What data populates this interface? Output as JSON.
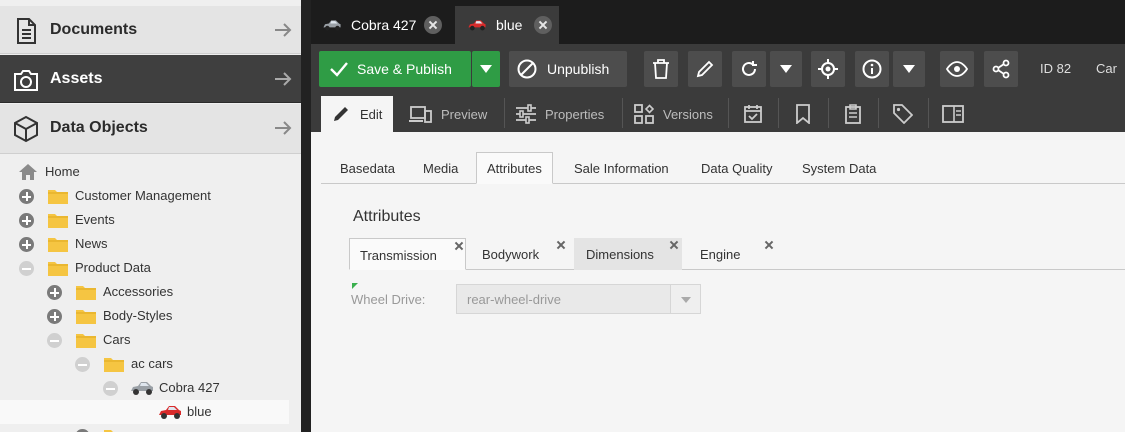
{
  "colors": {
    "accent_green": "#2f9c45",
    "dark_bar": "#3b3b3b",
    "car_grey": "#9aa0a6",
    "car_red": "#d92b2b",
    "folder": "#f5c542"
  },
  "sidebar": {
    "sections": [
      {
        "label": "Documents",
        "icon": "document-icon"
      },
      {
        "label": "Assets",
        "icon": "camera-icon"
      },
      {
        "label": "Data Objects",
        "icon": "cube-icon"
      }
    ],
    "tree": [
      {
        "label": "Home",
        "icon": "home-icon",
        "toggle": "none"
      },
      {
        "label": "Customer Management",
        "icon": "folder-icon",
        "toggle": "plus"
      },
      {
        "label": "Events",
        "icon": "folder-icon",
        "toggle": "plus"
      },
      {
        "label": "News",
        "icon": "folder-icon",
        "toggle": "plus"
      },
      {
        "label": "Product Data",
        "icon": "folder-icon",
        "toggle": "minus"
      },
      {
        "label": "Accessories",
        "icon": "folder-icon",
        "toggle": "plus"
      },
      {
        "label": "Body-Styles",
        "icon": "folder-icon",
        "toggle": "plus"
      },
      {
        "label": "Cars",
        "icon": "folder-icon",
        "toggle": "minus"
      },
      {
        "label": "ac cars",
        "icon": "folder-icon",
        "toggle": "minus"
      },
      {
        "label": "Cobra 427",
        "icon": "car-grey-icon",
        "toggle": "minus"
      },
      {
        "label": "blue",
        "icon": "car-red-icon",
        "toggle": "none",
        "selected": true
      }
    ]
  },
  "doc_tabs": [
    {
      "label": "Cobra 427",
      "icon": "car-grey-icon"
    },
    {
      "label": "blue",
      "icon": "car-red-icon",
      "active": true
    }
  ],
  "toolbar": {
    "save_publish": "Save & Publish",
    "unpublish": "Unpublish",
    "id_label": "ID 82",
    "class_label": "Car"
  },
  "edit_tabs": [
    {
      "label": "Edit",
      "icon": "pencil-icon",
      "active": true
    },
    {
      "label": "Preview",
      "icon": "devices-icon"
    },
    {
      "label": "Properties",
      "icon": "sliders-icon"
    },
    {
      "label": "Versions",
      "icon": "versions-icon"
    }
  ],
  "object_tabs": [
    "Basedata",
    "Media",
    "Attributes",
    "Sale Information",
    "Data Quality",
    "System Data"
  ],
  "section_title": "Attributes",
  "attribute_tabs": [
    "Transmission",
    "Bodywork",
    "Dimensions",
    "Engine"
  ],
  "field": {
    "label": "Wheel Drive:",
    "value": "rear-wheel-drive"
  }
}
